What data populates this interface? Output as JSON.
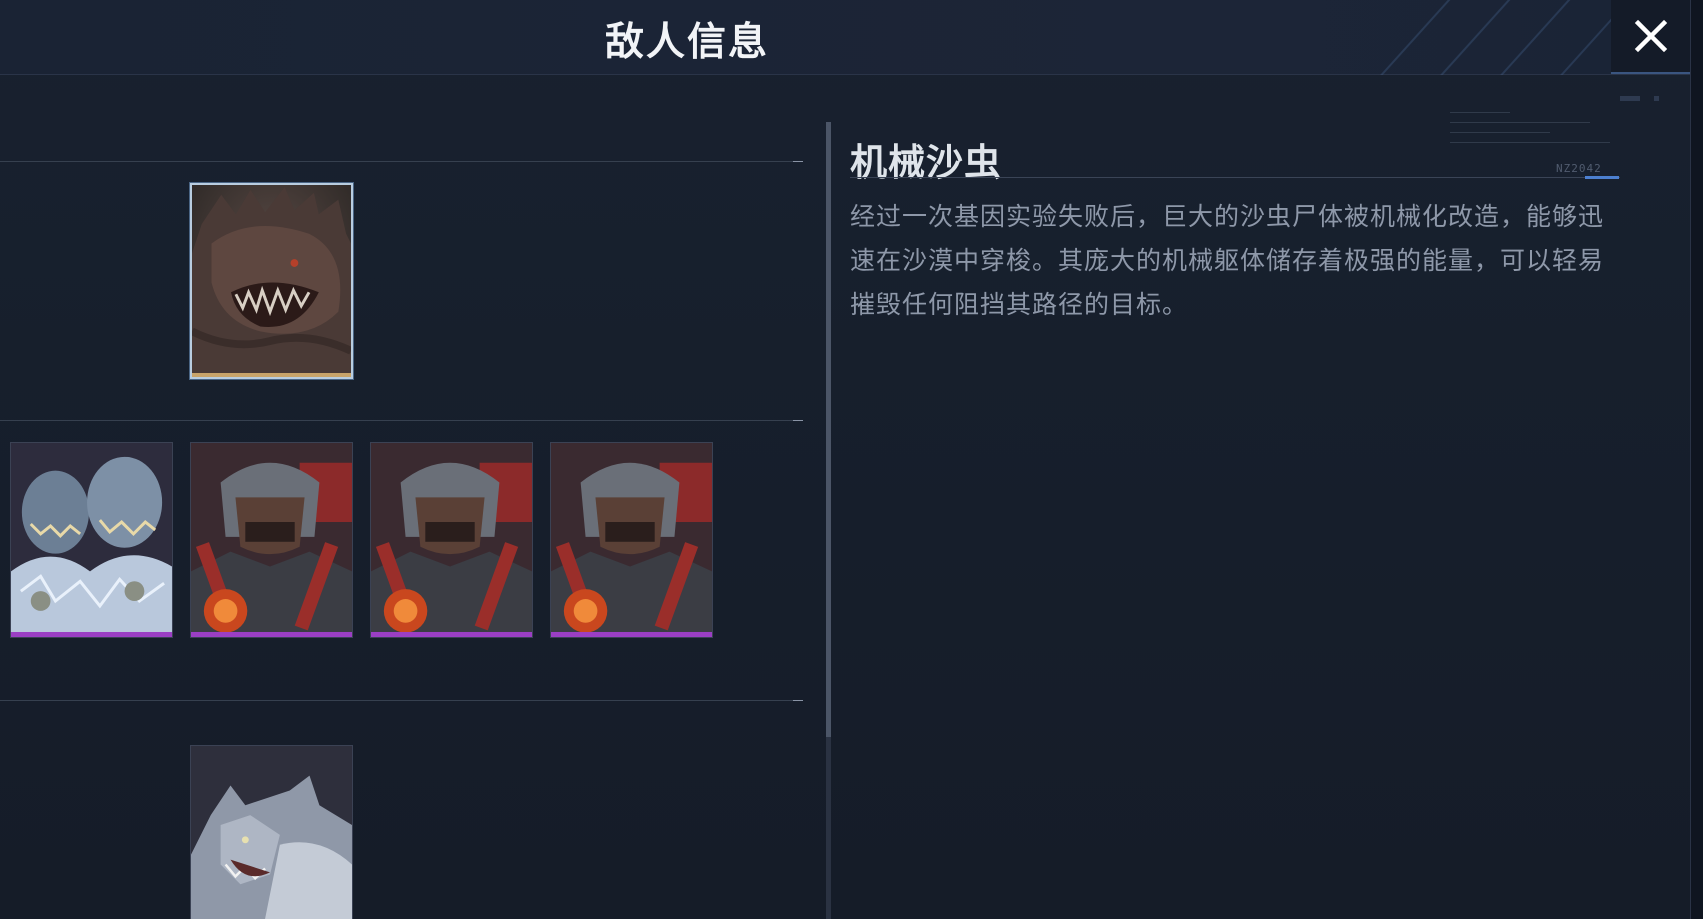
{
  "header": {
    "title": "敌人信息",
    "close_icon": "close-icon"
  },
  "enemy_list": {
    "sections": [
      {
        "cards": [
          {
            "id": "mech-sandworm",
            "label": "机械沙虫",
            "selected": true,
            "rarity_color": "#c9a46a"
          }
        ]
      },
      {
        "cards": [
          {
            "id": "frost-ogre",
            "selected": false,
            "rarity_color": "#9b3fc4"
          },
          {
            "id": "mech-soldier-1",
            "selected": false,
            "rarity_color": "#9b3fc4"
          },
          {
            "id": "mech-soldier-2",
            "selected": false,
            "rarity_color": "#9b3fc4"
          },
          {
            "id": "mech-soldier-3",
            "selected": false,
            "rarity_color": "#9b3fc4"
          }
        ]
      },
      {
        "cards": [
          {
            "id": "grey-wolf",
            "selected": false,
            "rarity_color": "#9b3fc4"
          }
        ]
      }
    ]
  },
  "detail": {
    "name": "机械沙虫",
    "code": "NZ2042",
    "description": "经过一次基因实验失败后，巨大的沙虫尸体被机械化改造，能够迅速在沙漠中穿梭。其庞大的机械躯体储存着极强的能量，可以轻易摧毁任何阻挡其路径的目标。"
  },
  "colors": {
    "background": "#151d2a",
    "accent_blue": "#4c7fcf",
    "epic_purple": "#9b3fc4",
    "selected_gold": "#c9a46a"
  }
}
